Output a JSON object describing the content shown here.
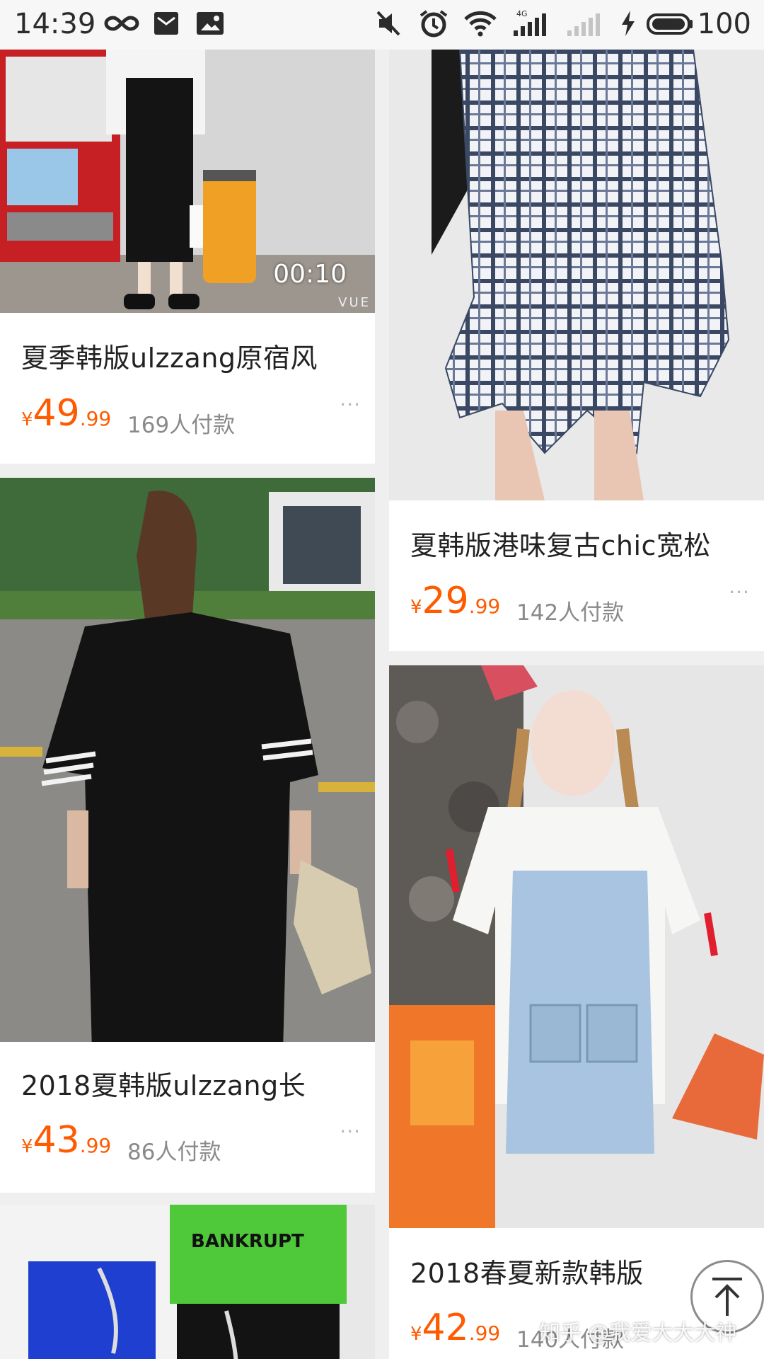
{
  "status_bar": {
    "time": "14:39",
    "battery": "100",
    "icons": [
      "infinity-icon",
      "mail-icon",
      "image-icon",
      "mute-icon",
      "alarm-icon",
      "wifi-icon",
      "signal-4g-icon",
      "signal-weak-icon",
      "charging-icon",
      "battery-icon"
    ]
  },
  "products": [
    {
      "title": "夏季韩版ulzzang原宿风",
      "currency": "¥",
      "price_int": "49",
      "price_dec": ".99",
      "sold": "169人付款",
      "more": "···",
      "duration": "00:10",
      "watermark_tag": "VUE"
    },
    {
      "title": "2018夏韩版ulzzang长",
      "currency": "¥",
      "price_int": "43",
      "price_dec": ".99",
      "sold": "86人付款",
      "more": "···"
    },
    {
      "title": "夏韩版港味复古chic宽松",
      "currency": "¥",
      "price_int": "29",
      "price_dec": ".99",
      "sold": "142人付款",
      "more": "···"
    },
    {
      "title": "2018春夏新款韩版",
      "currency": "¥",
      "price_int": "42",
      "price_dec": ".99",
      "sold": "140人付款",
      "more": "···"
    }
  ],
  "overlay": {
    "watermark": "知乎 @我爱大大大神"
  },
  "colors": {
    "accent": "#ff5a00",
    "background": "#efefef",
    "card": "#ffffff"
  }
}
